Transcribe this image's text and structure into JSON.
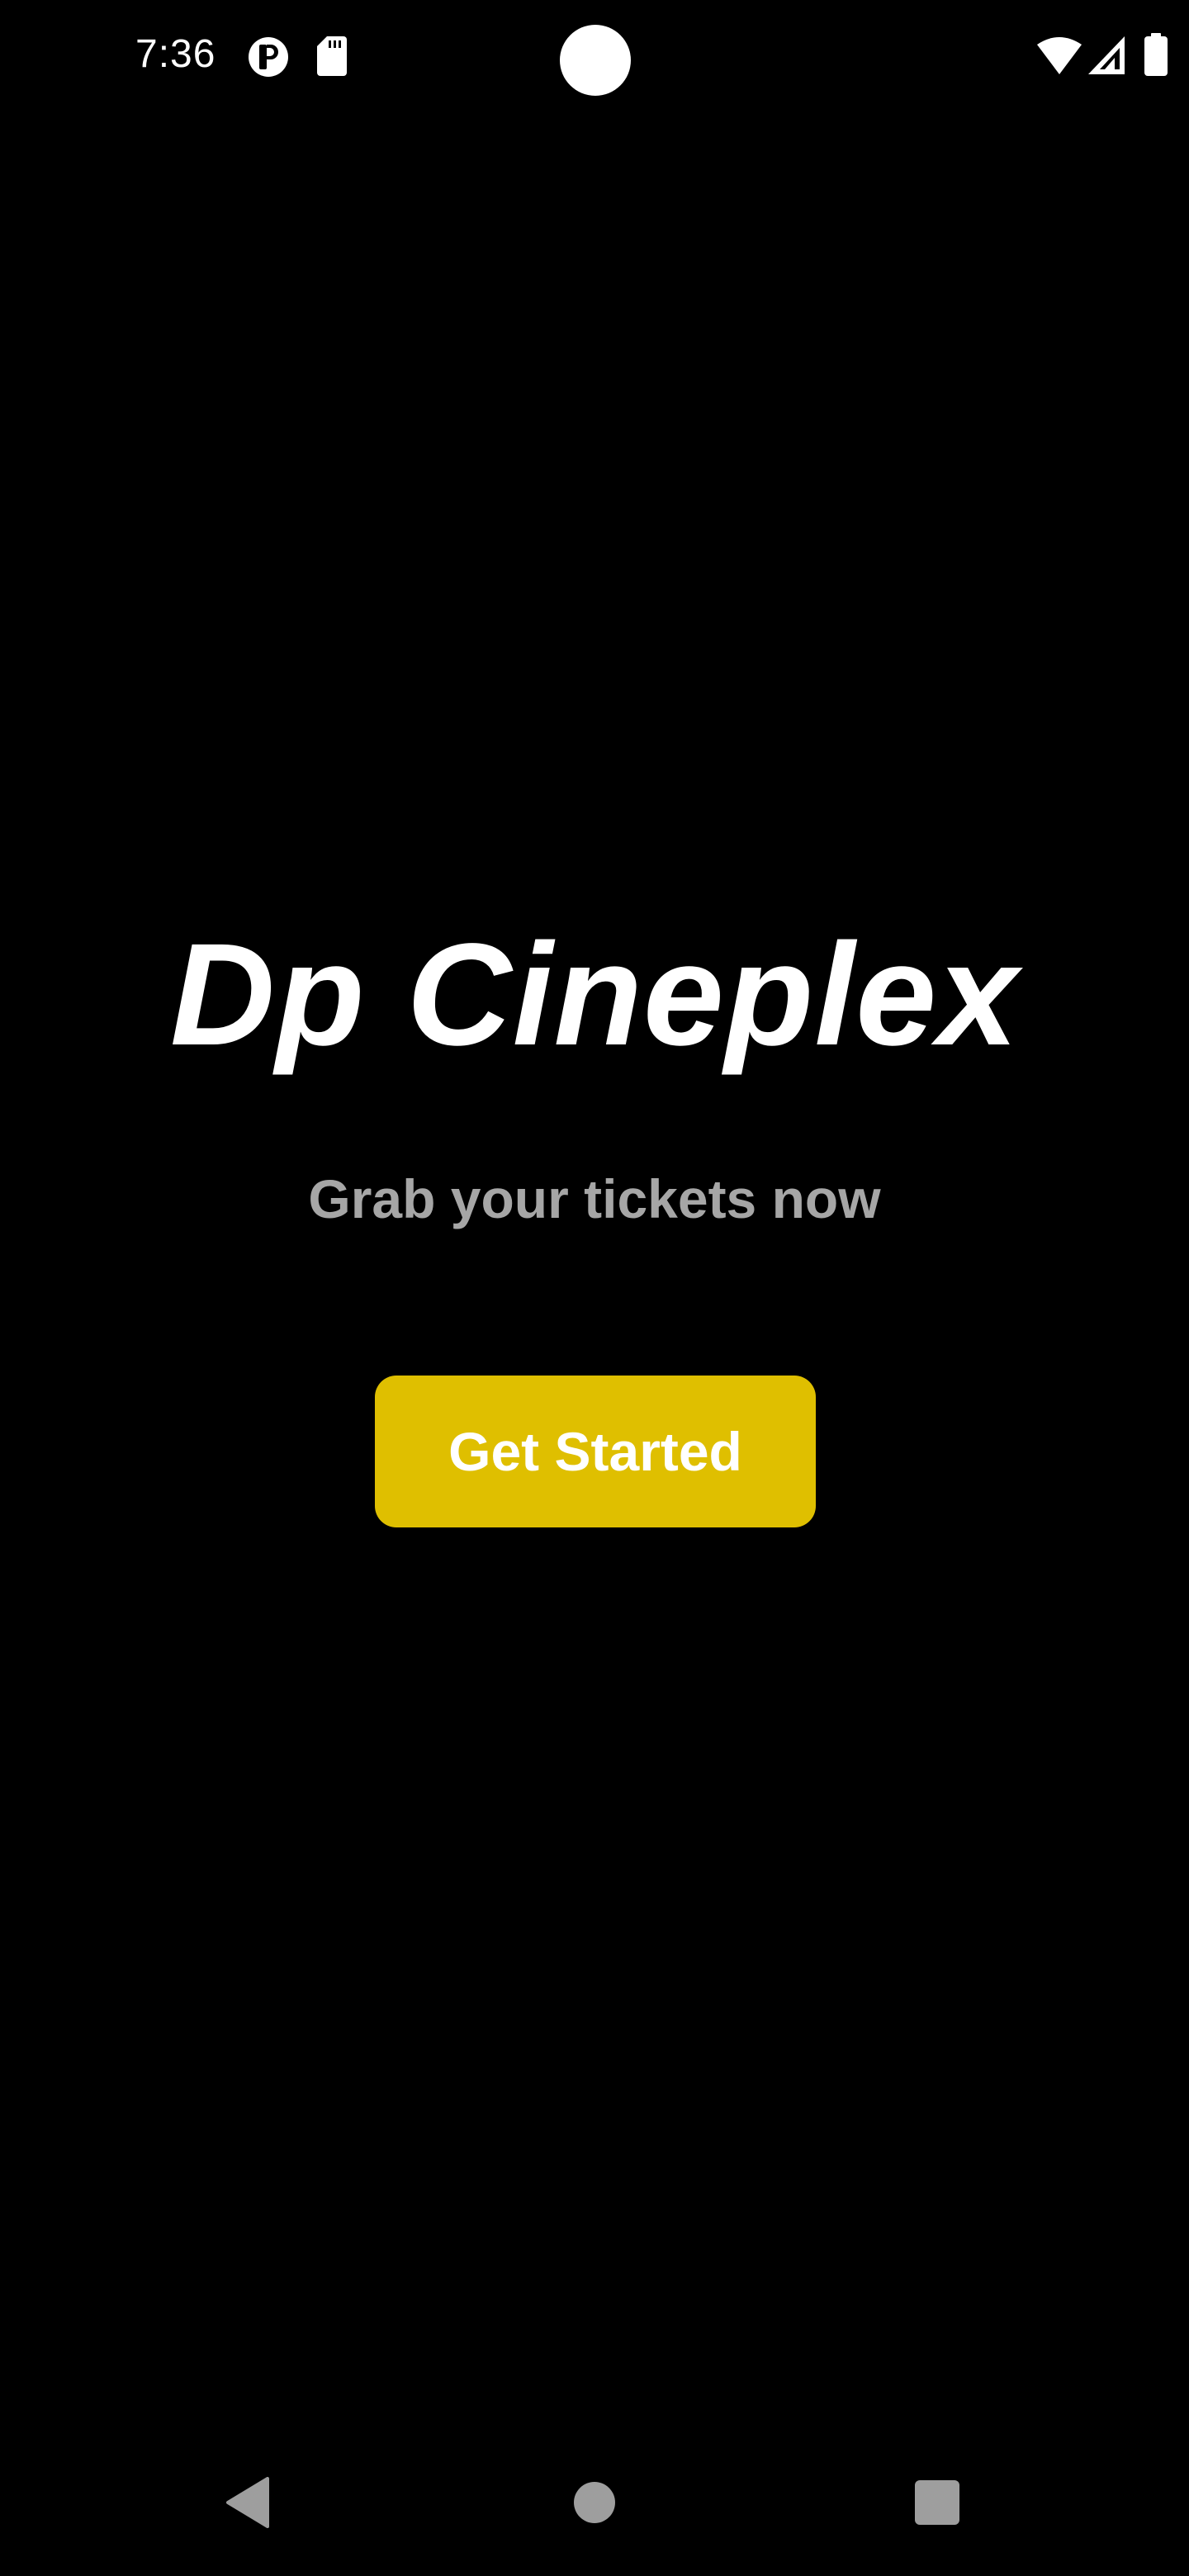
{
  "status_bar": {
    "time": "7:36",
    "icons": [
      "app-notification-icon",
      "sd-card-icon",
      "wifi-icon",
      "cellular-signal-icon",
      "battery-icon"
    ]
  },
  "main": {
    "title": "Dp Cineplex",
    "subtitle": "Grab your tickets now",
    "button_label": "Get Started"
  },
  "nav_bar": {
    "buttons": [
      "back-icon",
      "home-icon",
      "recents-icon"
    ]
  },
  "colors": {
    "background": "#000000",
    "title": "#ffffff",
    "subtitle": "#a6a6a6",
    "accent": "#dfbf00",
    "button_text": "#ffffff",
    "nav_icons": "#9e9e9e"
  }
}
